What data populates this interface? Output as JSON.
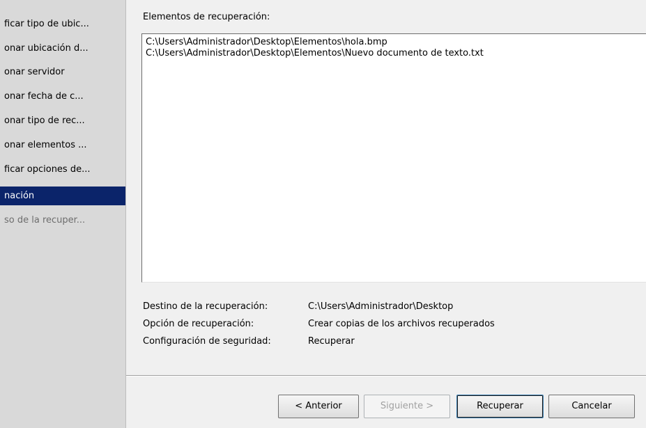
{
  "wizard": {
    "steps": [
      {
        "label": "ficar tipo de ubic...",
        "state": "normal"
      },
      {
        "label": "onar ubicación d...",
        "state": "normal"
      },
      {
        "label": "onar servidor",
        "state": "normal"
      },
      {
        "label": "onar fecha de c...",
        "state": "normal"
      },
      {
        "label": "onar tipo de rec...",
        "state": "normal"
      },
      {
        "label": "onar elementos ...",
        "state": "normal"
      },
      {
        "label": "ficar opciones de...",
        "state": "normal"
      },
      {
        "label": "nación",
        "state": "active"
      },
      {
        "label": "so de la recuper...",
        "state": "disabled"
      }
    ]
  },
  "main": {
    "items_label": "Elementos de recuperación:",
    "items": [
      "C:\\Users\\Administrador\\Desktop\\Elementos\\hola.bmp",
      "C:\\Users\\Administrador\\Desktop\\Elementos\\Nuevo documento de texto.txt"
    ],
    "summary": {
      "destination_label": "Destino de la recuperación:",
      "destination_value": "C:\\Users\\Administrador\\Desktop",
      "option_label": "Opción de recuperación:",
      "option_value": "Crear copias de los archivos recuperados",
      "security_label": "Configuración de seguridad:",
      "security_value": "Recuperar"
    }
  },
  "buttons": {
    "back": "< Anterior",
    "next": "Siguiente >",
    "recover": "Recuperar",
    "cancel": "Cancelar"
  },
  "colors": {
    "active_step_bg": "#0b246a",
    "sidebar_bg": "#d9d9d9",
    "window_bg": "#f0f0f0"
  }
}
